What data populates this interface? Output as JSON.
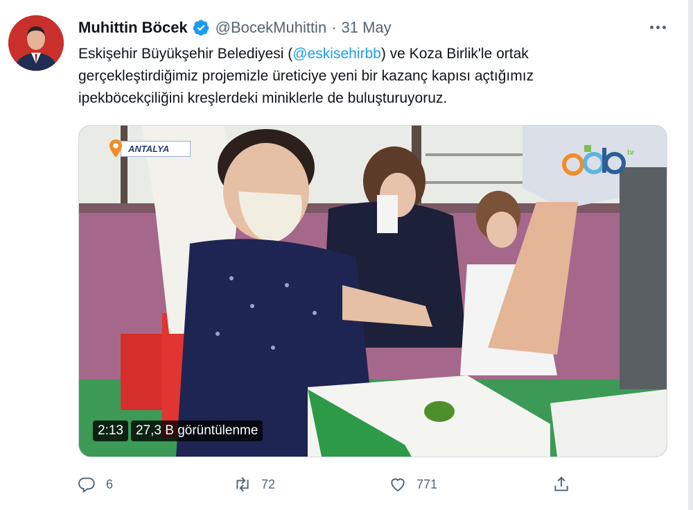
{
  "tweet": {
    "author_name": "Muhittin Böcek",
    "author_handle": "@BocekMuhittin",
    "separator": "·",
    "date": "31 May",
    "text_line1_prefix": "Eskişehir Büyükşehir Belediyesi (",
    "mention": "@eskisehirbb",
    "text_line1_suffix": ") ve Koza Birlik'le ortak",
    "text_line2": "gerçekleştirdiğimiz projemizle üreticiye yeni bir kazanç kapısı açtığımız",
    "text_line3": "ipekböcekçiliğini kreşlerdeki miniklerle de buluşturuyoruz."
  },
  "video": {
    "location": "ANTALYA",
    "duration": "2:13",
    "views": "27,3 B görüntülenme",
    "channel_logo_text": "tv"
  },
  "actions": {
    "replies": "6",
    "retweets": "72",
    "likes": "771"
  },
  "icons": [
    "verified-badge-icon",
    "more-icon",
    "location-pin-icon",
    "reply-icon",
    "retweet-icon",
    "like-icon",
    "share-icon"
  ],
  "colors": {
    "accent": "#1d9bf0",
    "secondary_text": "#536471",
    "primary_text": "#0f1419",
    "location_pin": "#f28c28"
  }
}
